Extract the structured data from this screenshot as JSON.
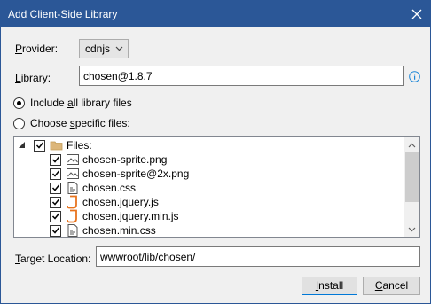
{
  "window": {
    "title": "Add Client-Side Library"
  },
  "provider": {
    "label_u": "P",
    "label_rest": "rovider:",
    "value": "cdnjs"
  },
  "library": {
    "label_u": "L",
    "label_rest": "ibrary:",
    "value": "chosen@1.8.7"
  },
  "options": {
    "include_all": {
      "pre": "Include ",
      "u": "a",
      "post": "ll library files",
      "selected": true
    },
    "choose_specific": {
      "pre": "Choose ",
      "u": "s",
      "post": "pecific files:",
      "selected": false
    }
  },
  "files": {
    "root_label": "Files:",
    "items": [
      {
        "name": "chosen-sprite.png",
        "icon": "image-file-icon",
        "checked": true
      },
      {
        "name": "chosen-sprite@2x.png",
        "icon": "image-file-icon",
        "checked": true
      },
      {
        "name": "chosen.css",
        "icon": "css-file-icon",
        "checked": true
      },
      {
        "name": "chosen.jquery.js",
        "icon": "js-file-icon",
        "checked": true
      },
      {
        "name": "chosen.jquery.min.js",
        "icon": "js-file-icon",
        "checked": true
      },
      {
        "name": "chosen.min.css",
        "icon": "css-file-icon",
        "checked": true
      }
    ]
  },
  "target": {
    "label_u": "T",
    "label_rest": "arget Location:",
    "value": "wwwroot/lib/chosen/"
  },
  "buttons": {
    "install": {
      "u": "I",
      "rest": "nstall"
    },
    "cancel": {
      "u": "C",
      "rest": "ancel"
    }
  },
  "colors": {
    "titlebar": "#2b5797",
    "accent": "#0078d7",
    "js_icon": "#e8731d",
    "folder": "#dcb67a"
  }
}
